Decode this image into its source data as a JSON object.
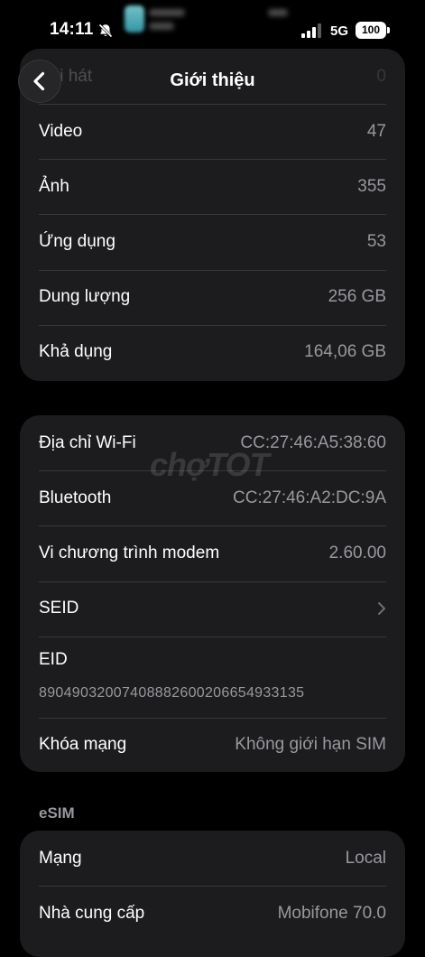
{
  "status_bar": {
    "time": "14:11",
    "network": "5G",
    "battery": "100"
  },
  "nav": {
    "title": "Giới thiệu"
  },
  "group1": {
    "rows": [
      {
        "label": "Bài hát",
        "value": "0"
      },
      {
        "label": "Video",
        "value": "47"
      },
      {
        "label": "Ảnh",
        "value": "355"
      },
      {
        "label": "Ứng dụng",
        "value": "53"
      },
      {
        "label": "Dung lượng",
        "value": "256 GB"
      },
      {
        "label": "Khả dụng",
        "value": "164,06 GB"
      }
    ]
  },
  "group2": {
    "wifi": {
      "label": "Địa chỉ Wi-Fi",
      "value": "CC:27:46:A5:38:60"
    },
    "bluetooth": {
      "label": "Bluetooth",
      "value": "CC:27:46:A2:DC:9A"
    },
    "modem": {
      "label": "Vi chương trình modem",
      "value": "2.60.00"
    },
    "seid": {
      "label": "SEID"
    },
    "eid": {
      "label": "EID",
      "value": "89049032007408882600206654933135"
    },
    "carrier_lock": {
      "label": "Khóa mạng",
      "value": "Không giới hạn SIM"
    }
  },
  "esim": {
    "header": "eSIM",
    "rows": [
      {
        "label": "Mạng",
        "value": "Local"
      },
      {
        "label": "Nhà cung cấp",
        "value": "Mobifone 70.0"
      }
    ]
  },
  "watermark": "chợTOT",
  "icons": {
    "back": "chevron-left-icon",
    "seid": "chevron-right-icon",
    "silent": "bell-off-icon",
    "signal": "signal-bars-icon"
  }
}
